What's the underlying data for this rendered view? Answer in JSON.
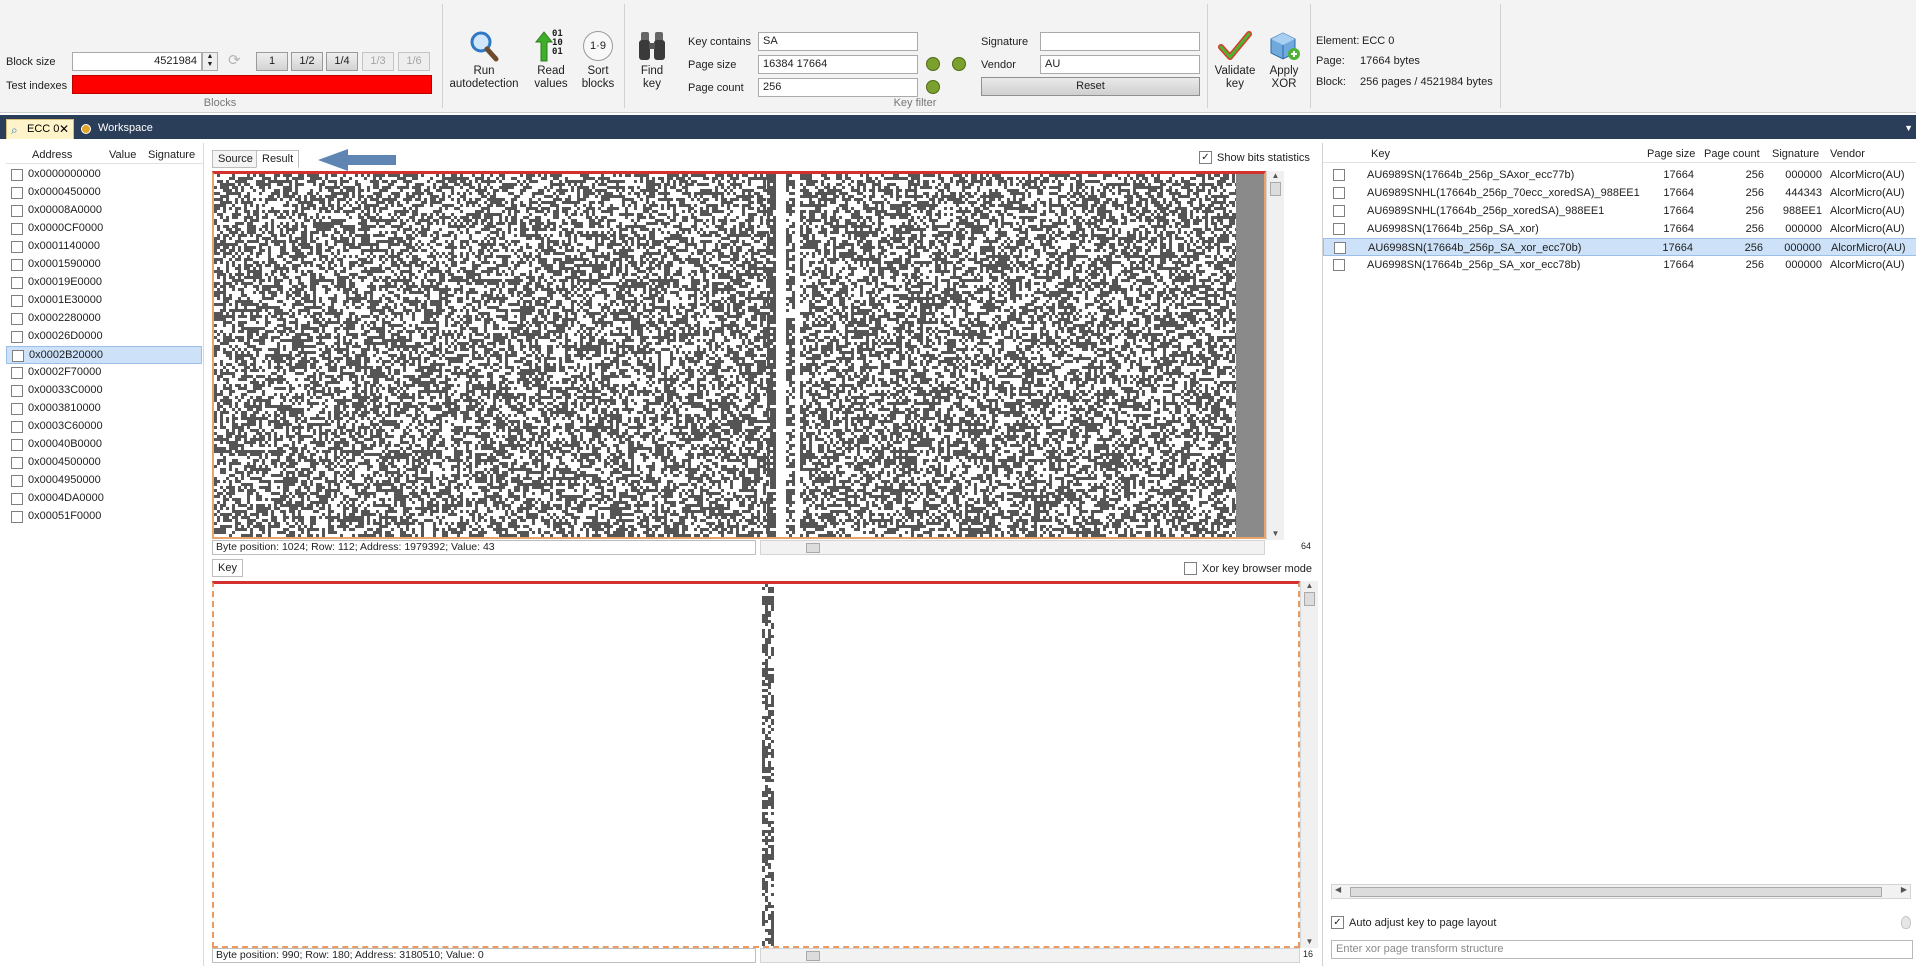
{
  "toolbar": {
    "block_size_label": "Block size",
    "block_size_value": "4521984",
    "test_indexes_label": "Test indexes",
    "test_indexes_color": "#ff0000",
    "step_buttons": [
      "1",
      "1/2",
      "1/4",
      "1/3",
      "1/6"
    ],
    "blocks_group_label": "Blocks",
    "run_autodetection": [
      "Run",
      "autodetection"
    ],
    "read_values": [
      "Read",
      "values"
    ],
    "sort_blocks": [
      "Sort",
      "blocks"
    ],
    "find_key": [
      "Find",
      "key"
    ],
    "sort_icon_text": "1·9",
    "read_icon_text": [
      "01",
      "10",
      "01"
    ],
    "key_contains_label": "Key contains",
    "key_contains_value": "SA",
    "page_size_label": "Page size",
    "page_size_value": "16384 17664",
    "page_count_label": "Page count",
    "page_count_value": "256",
    "signature_label": "Signature",
    "signature_value": "",
    "vendor_label": "Vendor",
    "vendor_value": "AU",
    "reset_label": "Reset",
    "key_filter_group_label": "Key filter",
    "validate_key": [
      "Validate",
      "key"
    ],
    "apply_xor": [
      "Apply",
      "XOR"
    ],
    "element_label": "Element:",
    "element_value": "ECC 0",
    "page_label": "Page:",
    "page_value": "17664 bytes",
    "block_label": "Block:",
    "block_value": "256 pages / 4521984 bytes"
  },
  "tabs": [
    {
      "label": "ECC 0",
      "active": true
    },
    {
      "label": "Workspace",
      "active": false
    }
  ],
  "left_panel": {
    "columns": [
      "Address",
      "Value",
      "Signature"
    ],
    "rows": [
      "0x0000000000",
      "0x0000450000",
      "0x00008A0000",
      "0x0000CF0000",
      "0x0001140000",
      "0x0001590000",
      "0x00019E0000",
      "0x0001E30000",
      "0x0002280000",
      "0x00026D0000",
      "0x0002B20000",
      "0x0002F70000",
      "0x00033C0000",
      "0x0003810000",
      "0x0003C60000",
      "0x00040B0000",
      "0x0004500000",
      "0x0004950000",
      "0x0004DA0000",
      "0x00051F0000"
    ],
    "selected_index": 10
  },
  "center": {
    "source_tab": "Source",
    "result_tab": "Result",
    "show_bits_label": "Show bits statistics",
    "show_bits_checked": true,
    "top_status": "Byte position: 1024; Row: 112; Address: 1979392; Value: 43",
    "top_scroll_number": "64",
    "key_tab": "Key",
    "xor_browser_label": "Xor key browser mode",
    "xor_browser_checked": false,
    "bottom_status": "Byte position: 990; Row: 180; Address: 3180510; Value: 0",
    "bottom_scroll_number": "16"
  },
  "right_panel": {
    "columns": [
      "Key",
      "Page size",
      "Page count",
      "Signature",
      "Vendor"
    ],
    "rows": [
      {
        "key": "AU6989SN(17664b_256p_SAxor_ecc77b)",
        "page_size": "17664",
        "page_count": "256",
        "signature": "000000",
        "vendor": "AlcorMicro(AU)"
      },
      {
        "key": "AU6989SNHL(17664b_256p_70ecc_xoredSA)_988EE1",
        "page_size": "17664",
        "page_count": "256",
        "signature": "444343",
        "vendor": "AlcorMicro(AU)"
      },
      {
        "key": "AU6989SNHL(17664b_256p_xoredSA)_988EE1",
        "page_size": "17664",
        "page_count": "256",
        "signature": "988EE1",
        "vendor": "AlcorMicro(AU)"
      },
      {
        "key": "AU6998SN(17664b_256p_SA_xor)",
        "page_size": "17664",
        "page_count": "256",
        "signature": "000000",
        "vendor": "AlcorMicro(AU)"
      },
      {
        "key": "AU6998SN(17664b_256p_SA_xor_ecc70b)",
        "page_size": "17664",
        "page_count": "256",
        "signature": "000000",
        "vendor": "AlcorMicro(AU)"
      },
      {
        "key": "AU6998SN(17664b_256p_SA_xor_ecc78b)",
        "page_size": "17664",
        "page_count": "256",
        "signature": "000000",
        "vendor": "AlcorMicro(AU)"
      }
    ],
    "selected_index": 4,
    "auto_adjust_label": "Auto adjust key to page layout",
    "auto_adjust_checked": true,
    "xor_transform_placeholder": "Enter xor page transform structure"
  },
  "colors": {
    "tabbar": "#2a3d59",
    "selection": "#cde2f8",
    "red_border": "#d43030",
    "orange_border": "#e8a56a",
    "bit_dark": "#555555"
  }
}
